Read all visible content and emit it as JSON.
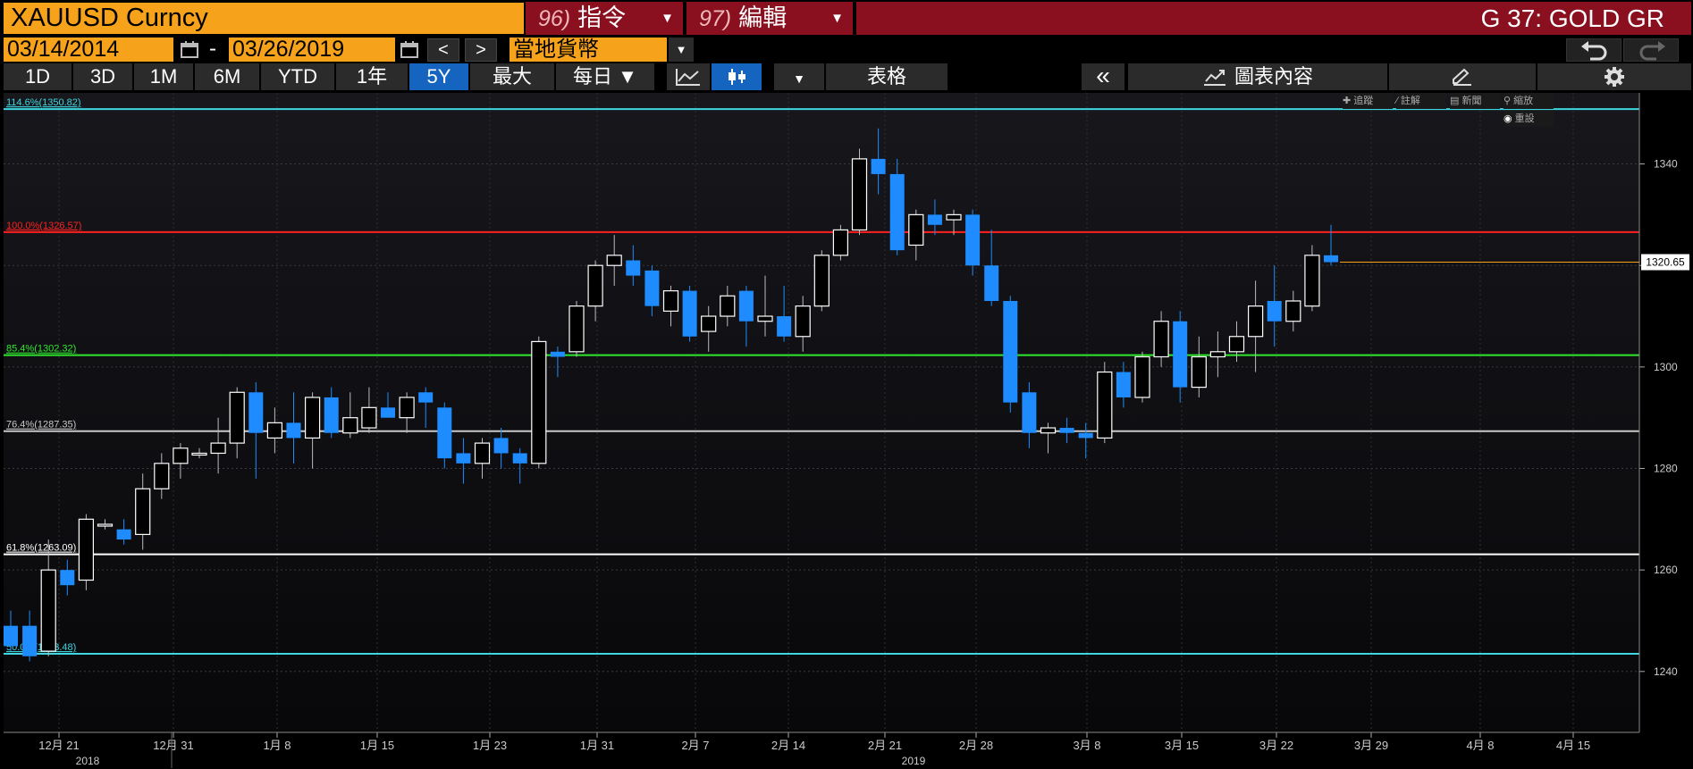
{
  "header": {
    "ticker": "XAUUSD Curncy",
    "cmd96": {
      "num": "96)",
      "label": "指令"
    },
    "cmd97": {
      "num": "97)",
      "label": "編輯"
    },
    "title": "G 37: GOLD GR"
  },
  "dates": {
    "start": "03/14/2014",
    "end": "03/26/2019",
    "separator": "-",
    "prev": "<",
    "next": ">",
    "currency": "當地貨幣"
  },
  "toolbar": {
    "ranges": [
      {
        "label": "1D",
        "active": false
      },
      {
        "label": "3D",
        "active": false
      },
      {
        "label": "1M",
        "active": false
      },
      {
        "label": "6M",
        "active": false
      },
      {
        "label": "YTD",
        "active": false
      },
      {
        "label": "1年",
        "active": false
      },
      {
        "label": "5Y",
        "active": true
      },
      {
        "label": "最大",
        "active": false
      }
    ],
    "frequency": "每日 ▼",
    "table": "表格",
    "collapse": "«",
    "chart_content": "圖表內容"
  },
  "chart_tools": {
    "track": "追蹤",
    "annotate": "註解",
    "news": "新聞",
    "zoom": "縮放",
    "reset": "重設"
  },
  "chart_data": {
    "type": "candlestick",
    "ylim": [
      1228,
      1354
    ],
    "y_ticks": [
      1240,
      1260,
      1280,
      1300,
      1320,
      1340
    ],
    "last_price_label": "1320.65",
    "last_price": 1320.65,
    "x_ticks": [
      "12月 21",
      "12月 31",
      "1月 8",
      "1月 15",
      "1月 23",
      "1月 31",
      "2月 7",
      "2月 14",
      "2月 21",
      "2月 28",
      "3月 8",
      "3月 15",
      "3月 22",
      "3月 29",
      "4月 8",
      "4月 15"
    ],
    "year_labels": [
      {
        "label": "2018",
        "after_tick": 0
      },
      {
        "label": "2019",
        "after_tick": 8
      }
    ],
    "fib_levels": [
      {
        "label": "114.6%(1350.82)",
        "value": 1350.82,
        "color": "#3ed6e0"
      },
      {
        "label": "100.0%(1326.57)",
        "value": 1326.57,
        "color": "#ff2020"
      },
      {
        "label": "85.4%(1302.32)",
        "value": 1302.32,
        "color": "#2ee82e"
      },
      {
        "label": "76.4%(1287.35)",
        "value": 1287.35,
        "color": "#c8c8c8"
      },
      {
        "label": "61.8%(1263.09)",
        "value": 1263.09,
        "color": "#ffffff"
      },
      {
        "label": "50.0%(1243.48)",
        "value": 1243.48,
        "color": "#3ed6e0"
      }
    ],
    "candles": [
      {
        "o": 1249,
        "h": 1252,
        "l": 1244,
        "c": 1245
      },
      {
        "o": 1249,
        "h": 1252,
        "l": 1242,
        "c": 1243
      },
      {
        "o": 1244,
        "h": 1266,
        "l": 1243,
        "c": 1260
      },
      {
        "o": 1260,
        "h": 1262,
        "l": 1255,
        "c": 1257
      },
      {
        "o": 1258,
        "h": 1271,
        "l": 1256,
        "c": 1270
      },
      {
        "o": 1269,
        "h": 1270,
        "l": 1268,
        "c": 1269
      },
      {
        "o": 1268,
        "h": 1270,
        "l": 1265,
        "c": 1266
      },
      {
        "o": 1267,
        "h": 1279,
        "l": 1264,
        "c": 1276
      },
      {
        "o": 1276,
        "h": 1283,
        "l": 1274,
        "c": 1281
      },
      {
        "o": 1281,
        "h": 1285,
        "l": 1278,
        "c": 1284
      },
      {
        "o": 1283,
        "h": 1284,
        "l": 1282,
        "c": 1283
      },
      {
        "o": 1283,
        "h": 1290,
        "l": 1279,
        "c": 1285
      },
      {
        "o": 1285,
        "h": 1296,
        "l": 1282,
        "c": 1295
      },
      {
        "o": 1295,
        "h": 1297,
        "l": 1278,
        "c": 1287
      },
      {
        "o": 1286,
        "h": 1292,
        "l": 1283,
        "c": 1289
      },
      {
        "o": 1289,
        "h": 1295,
        "l": 1281,
        "c": 1286
      },
      {
        "o": 1286,
        "h": 1295,
        "l": 1280,
        "c": 1294
      },
      {
        "o": 1294,
        "h": 1296,
        "l": 1286,
        "c": 1287
      },
      {
        "o": 1287,
        "h": 1295,
        "l": 1286,
        "c": 1290
      },
      {
        "o": 1288,
        "h": 1296,
        "l": 1287,
        "c": 1292
      },
      {
        "o": 1292,
        "h": 1295,
        "l": 1290,
        "c": 1290
      },
      {
        "o": 1290,
        "h": 1295,
        "l": 1287,
        "c": 1294
      },
      {
        "o": 1295,
        "h": 1296,
        "l": 1288,
        "c": 1293
      },
      {
        "o": 1292,
        "h": 1293,
        "l": 1280,
        "c": 1282
      },
      {
        "o": 1283,
        "h": 1286,
        "l": 1277,
        "c": 1281
      },
      {
        "o": 1281,
        "h": 1286,
        "l": 1278,
        "c": 1285
      },
      {
        "o": 1286,
        "h": 1288,
        "l": 1280,
        "c": 1283
      },
      {
        "o": 1283,
        "h": 1284,
        "l": 1277,
        "c": 1281
      },
      {
        "o": 1281,
        "h": 1306,
        "l": 1280,
        "c": 1305
      },
      {
        "o": 1303,
        "h": 1304,
        "l": 1298,
        "c": 1302
      },
      {
        "o": 1303,
        "h": 1313,
        "l": 1302,
        "c": 1312
      },
      {
        "o": 1312,
        "h": 1321,
        "l": 1309,
        "c": 1320
      },
      {
        "o": 1320,
        "h": 1326,
        "l": 1316,
        "c": 1322
      },
      {
        "o": 1321,
        "h": 1324,
        "l": 1316,
        "c": 1318
      },
      {
        "o": 1319,
        "h": 1320,
        "l": 1310,
        "c": 1312
      },
      {
        "o": 1311,
        "h": 1316,
        "l": 1308,
        "c": 1315
      },
      {
        "o": 1315,
        "h": 1316,
        "l": 1305,
        "c": 1306
      },
      {
        "o": 1307,
        "h": 1312,
        "l": 1303,
        "c": 1310
      },
      {
        "o": 1310,
        "h": 1316,
        "l": 1308,
        "c": 1314
      },
      {
        "o": 1315,
        "h": 1316,
        "l": 1304,
        "c": 1309
      },
      {
        "o": 1309,
        "h": 1318,
        "l": 1306,
        "c": 1310
      },
      {
        "o": 1310,
        "h": 1316,
        "l": 1305,
        "c": 1306
      },
      {
        "o": 1306,
        "h": 1314,
        "l": 1303,
        "c": 1312
      },
      {
        "o": 1312,
        "h": 1323,
        "l": 1311,
        "c": 1322
      },
      {
        "o": 1322,
        "h": 1328,
        "l": 1321,
        "c": 1327
      },
      {
        "o": 1327,
        "h": 1343,
        "l": 1326,
        "c": 1341
      },
      {
        "o": 1341,
        "h": 1347,
        "l": 1334,
        "c": 1338
      },
      {
        "o": 1338,
        "h": 1341,
        "l": 1322,
        "c": 1323
      },
      {
        "o": 1324,
        "h": 1331,
        "l": 1321,
        "c": 1330
      },
      {
        "o": 1330,
        "h": 1333,
        "l": 1326,
        "c": 1328
      },
      {
        "o": 1329,
        "h": 1331,
        "l": 1326,
        "c": 1330
      },
      {
        "o": 1330,
        "h": 1331,
        "l": 1318,
        "c": 1320
      },
      {
        "o": 1320,
        "h": 1327,
        "l": 1312,
        "c": 1313
      },
      {
        "o": 1313,
        "h": 1314,
        "l": 1291,
        "c": 1293
      },
      {
        "o": 1295,
        "h": 1297,
        "l": 1284,
        "c": 1287
      },
      {
        "o": 1287,
        "h": 1289,
        "l": 1283,
        "c": 1288
      },
      {
        "o": 1288,
        "h": 1290,
        "l": 1285,
        "c": 1287
      },
      {
        "o": 1287,
        "h": 1289,
        "l": 1282,
        "c": 1286
      },
      {
        "o": 1286,
        "h": 1301,
        "l": 1285,
        "c": 1299
      },
      {
        "o": 1299,
        "h": 1301,
        "l": 1292,
        "c": 1294
      },
      {
        "o": 1294,
        "h": 1303,
        "l": 1293,
        "c": 1302
      },
      {
        "o": 1302,
        "h": 1311,
        "l": 1300,
        "c": 1309
      },
      {
        "o": 1309,
        "h": 1311,
        "l": 1293,
        "c": 1296
      },
      {
        "o": 1296,
        "h": 1306,
        "l": 1294,
        "c": 1302
      },
      {
        "o": 1302,
        "h": 1307,
        "l": 1298,
        "c": 1303
      },
      {
        "o": 1303,
        "h": 1309,
        "l": 1301,
        "c": 1306
      },
      {
        "o": 1306,
        "h": 1317,
        "l": 1299,
        "c": 1312
      },
      {
        "o": 1313,
        "h": 1320,
        "l": 1304,
        "c": 1309
      },
      {
        "o": 1309,
        "h": 1315,
        "l": 1307,
        "c": 1313
      },
      {
        "o": 1312,
        "h": 1324,
        "l": 1311,
        "c": 1322
      },
      {
        "o": 1322,
        "h": 1328,
        "l": 1320,
        "c": 1320.65
      }
    ]
  },
  "colors": {
    "up": "#ffffff",
    "down": "#1e8cff",
    "accent_orange": "#f7a21b",
    "brand_red": "#8a1020",
    "active_blue": "#1565c0",
    "last_price_line": "#f7a21b"
  }
}
